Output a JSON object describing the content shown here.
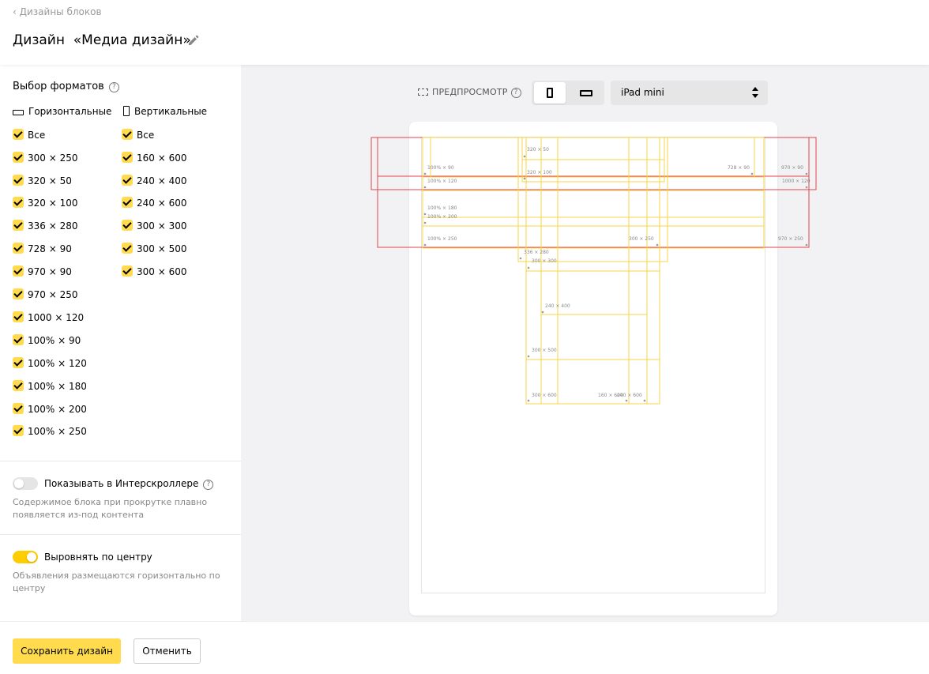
{
  "header": {
    "back_link": "‹ Дизайны блоков",
    "title_prefix": "Дизайн",
    "design_name": "«Медиа дизайн»"
  },
  "formats": {
    "title": "Выбор форматов",
    "horizontal_label": "Горизонтальные",
    "vertical_label": "Вертикальные",
    "horizontal": [
      {
        "label": "Все",
        "checked": true
      },
      {
        "label": "300 × 250",
        "checked": true
      },
      {
        "label": "320 × 50",
        "checked": true
      },
      {
        "label": "320 × 100",
        "checked": true
      },
      {
        "label": "336 × 280",
        "checked": true
      },
      {
        "label": "728 × 90",
        "checked": true
      },
      {
        "label": "970 × 90",
        "checked": true
      },
      {
        "label": "970 × 250",
        "checked": true
      },
      {
        "label": "1000 × 120",
        "checked": true
      },
      {
        "label": "100% × 90",
        "checked": true
      },
      {
        "label": "100% × 120",
        "checked": true
      },
      {
        "label": "100% × 180",
        "checked": true
      },
      {
        "label": "100% × 200",
        "checked": true
      },
      {
        "label": "100% × 250",
        "checked": true
      }
    ],
    "vertical": [
      {
        "label": "Все",
        "checked": true
      },
      {
        "label": "160 × 600",
        "checked": true
      },
      {
        "label": "240 × 400",
        "checked": true
      },
      {
        "label": "240 × 600",
        "checked": true
      },
      {
        "label": "300 × 300",
        "checked": true
      },
      {
        "label": "300 × 500",
        "checked": true
      },
      {
        "label": "300 × 600",
        "checked": true
      }
    ]
  },
  "interscroller": {
    "label": "Показывать в Интерскроллере",
    "enabled": false,
    "description": "Содержимое блока при прокрутке плавно появляется из-под контента"
  },
  "center_align": {
    "label": "Выровнять по центру",
    "enabled": true,
    "description": "Объявления размещаются горизонтально по центру"
  },
  "preview": {
    "label": "ПРЕДПРОСМОТР",
    "orientation": "portrait",
    "device": "iPad mini",
    "frame_labels": {
      "f_100x90": "100% × 90",
      "f_100x120": "100% × 120",
      "f_100x180": "100% × 180",
      "f_100x200": "100% × 200",
      "f_100x250": "100% × 250",
      "f_320x50": "320 × 50",
      "f_320x100": "320 × 100",
      "f_728x90": "728 × 90",
      "f_970x90": "970 × 90",
      "f_1000x120": "1000 × 120",
      "f_970x250": "970 × 250",
      "f_300x250": "300 × 250",
      "f_336x280": "336 × 280",
      "f_300x300": "300 × 300",
      "f_240x400": "240 × 400",
      "f_300x500": "300 × 500",
      "f_300x600": "300 × 600",
      "f_160x600": "160 × 600",
      "f_240x600": "240 × 600"
    },
    "colors": {
      "fit_frame": "#f5d547",
      "overflow_frame": "#e0474c"
    }
  },
  "footer": {
    "save_label": "Сохранить дизайн",
    "cancel_label": "Отменить"
  }
}
